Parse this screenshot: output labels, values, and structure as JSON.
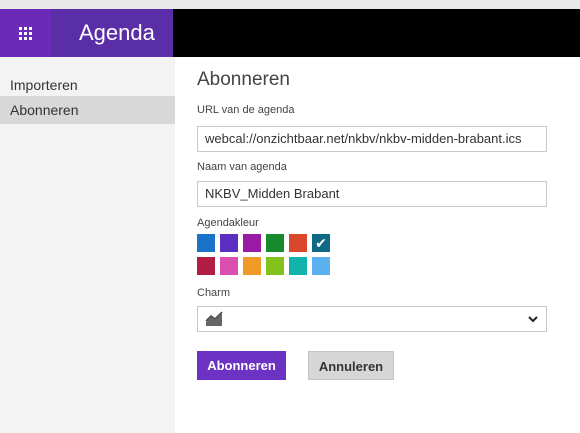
{
  "app": {
    "name": "Agenda"
  },
  "sidebar": {
    "items": [
      {
        "label": "Importeren",
        "selected": false
      },
      {
        "label": "Abonneren",
        "selected": true
      }
    ]
  },
  "form": {
    "title": "Abonneren",
    "url_label": "URL van de agenda",
    "url_value": "webcal://onzichtbaar.net/nkbv/nkbv-midden-brabant.ics",
    "name_label": "Naam van agenda",
    "name_value": "NKBV_Midden Brabant",
    "color_label": "Agendakleur",
    "colors": [
      {
        "hex": "#1a73c9",
        "selected": false
      },
      {
        "hex": "#5a2fc1",
        "selected": false
      },
      {
        "hex": "#9a1aa5",
        "selected": false
      },
      {
        "hex": "#168a2c",
        "selected": false
      },
      {
        "hex": "#d9482b",
        "selected": false
      },
      {
        "hex": "#0f6a86",
        "selected": true
      },
      {
        "hex": "#b21e43",
        "selected": false
      },
      {
        "hex": "#db4fb0",
        "selected": false
      },
      {
        "hex": "#f29a28",
        "selected": false
      },
      {
        "hex": "#83c11b",
        "selected": false
      },
      {
        "hex": "#13b3ad",
        "selected": false
      },
      {
        "hex": "#5bb1f0",
        "selected": false
      }
    ],
    "charm_label": "Charm",
    "charm_value_icon": "line-chart-icon",
    "subscribe_button": "Abonneren",
    "cancel_button": "Annuleren"
  },
  "theme": {
    "accent": "#6b32c3",
    "topbar": "#000000"
  }
}
